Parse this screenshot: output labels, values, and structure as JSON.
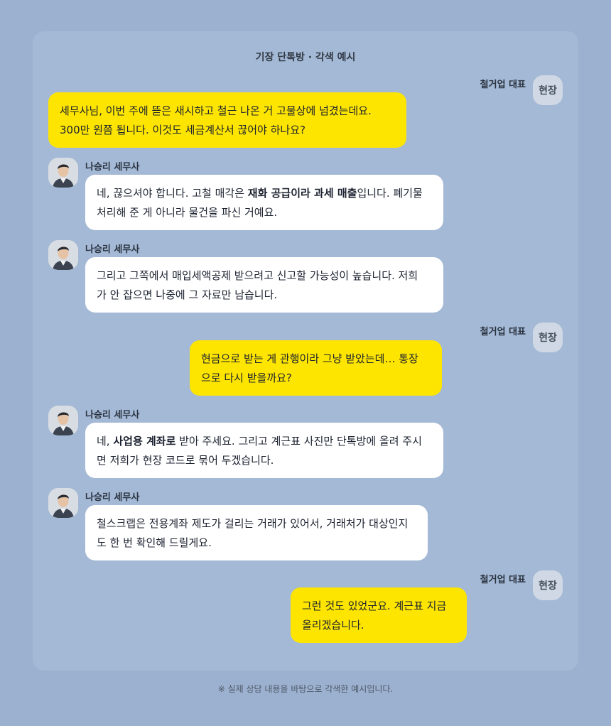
{
  "header": {
    "title": "기장 단톡방 · 각색 예시"
  },
  "participants": {
    "client": {
      "name": "철거업 대표",
      "avatar_text": "현장"
    },
    "advisor": {
      "name": "나승리 세무사",
      "avatar": "person-photo"
    }
  },
  "messages": [
    {
      "sender": "client",
      "lines": [
        "세무사님, 이번 주에 뜯은 새시하고 철근 나온 거 고물상에 넘겼는데요.",
        "300만 원쯤 됩니다. 이것도 세금계산서 끊어야 하나요?"
      ]
    },
    {
      "sender": "advisor",
      "line1_pre": "네, 끊으셔야 합니다. 고철 매각은 ",
      "line1_bold": "재화 공급이라 과세 매출",
      "line1_post": "입니다. 폐기물",
      "line2": "처리해 준 게 아니라 물건을 파신 거예요."
    },
    {
      "sender": "advisor",
      "lines": [
        "그리고 그쪽에서 매입세액공제 받으려고 신고할 가능성이 높습니다. 저희",
        "가 안 잡으면 나중에 그 자료만 남습니다."
      ]
    },
    {
      "sender": "client",
      "lines": [
        "현금으로 받는 게 관행이라 그냥 받았는데… 통장",
        "으로 다시 받을까요?"
      ]
    },
    {
      "sender": "advisor",
      "line1_pre": "네, ",
      "line1_bold": "사업용 계좌로",
      "line1_post": " 받아 주세요. 그리고 계근표 사진만 단톡방에 올려 주시",
      "line2": "면 저희가 현장 코드로 묶어 두겠습니다."
    },
    {
      "sender": "advisor",
      "lines": [
        "철스크랩은 전용계좌 제도가 걸리는 거래가 있어서, 거래처가 대상인지",
        "도 한 번 확인해 드릴게요."
      ]
    },
    {
      "sender": "client",
      "lines": [
        "그런 것도 있었군요. 계근표 지금",
        "올리겠습니다."
      ]
    }
  ],
  "footer": {
    "note": "※ 실제 상담 내용을 바탕으로 각색한 예시입니다."
  },
  "colors": {
    "background": "#9cb1cf",
    "panel": "#a3b9d5",
    "client_bubble": "#fee500",
    "advisor_bubble": "#ffffff"
  }
}
